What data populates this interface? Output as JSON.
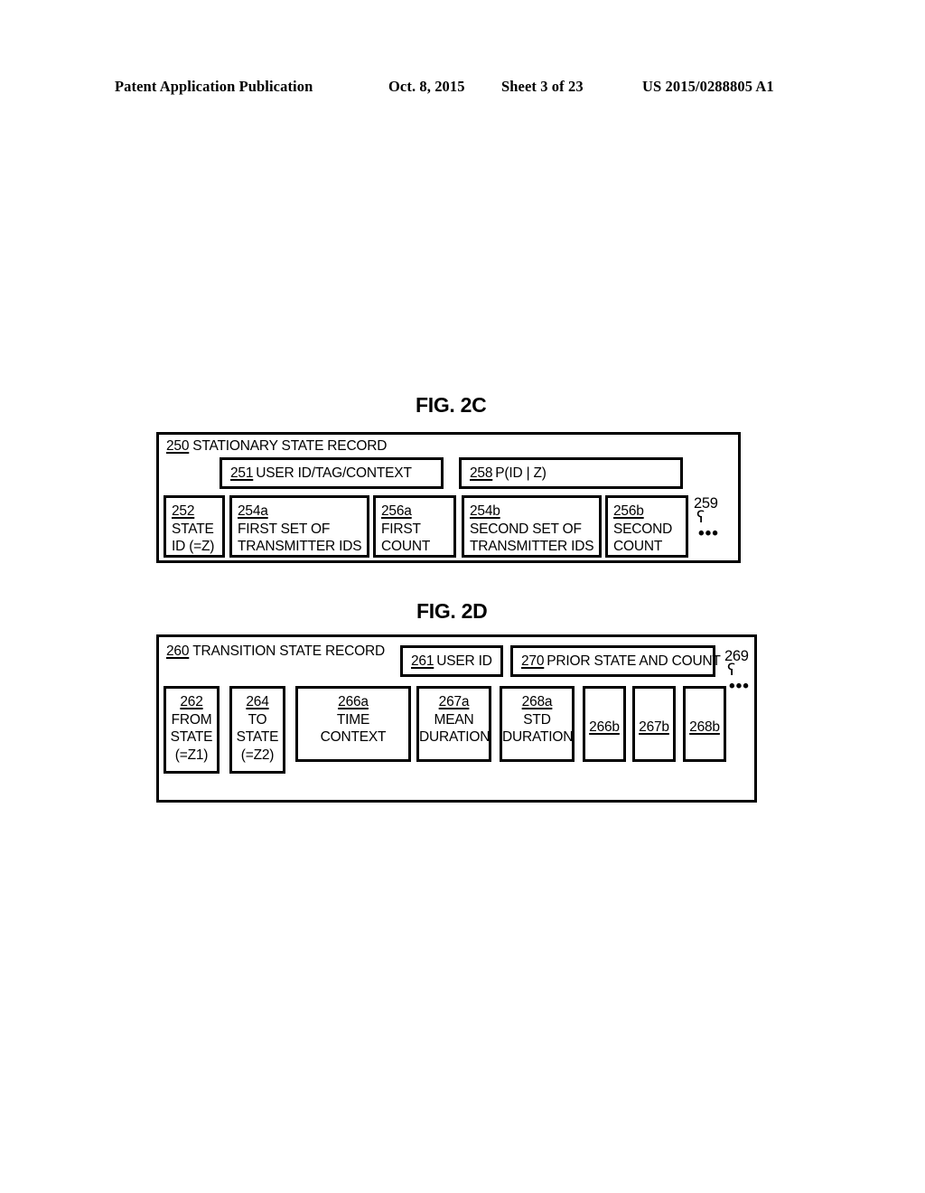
{
  "header": {
    "publication": "Patent Application Publication",
    "date": "Oct. 8, 2015",
    "sheet": "Sheet 3 of 23",
    "patent_number": "US 2015/0288805 A1"
  },
  "figures": [
    {
      "id": "fig-2c",
      "title": "FIG. 2C",
      "record": {
        "ref": "250",
        "label": "STATIONARY STATE RECORD"
      },
      "label_row": [
        {
          "ref": "251",
          "label": "USER ID/TAG/CONTEXT"
        },
        {
          "ref": "258",
          "label": "P(ID | Z)"
        }
      ],
      "field_row": [
        {
          "ref": "252",
          "lines": [
            "STATE",
            "ID (=Z)"
          ]
        },
        {
          "ref": "254a",
          "lines": [
            "FIRST SET OF",
            "TRANSMITTER IDS"
          ]
        },
        {
          "ref": "256a",
          "lines": [
            "FIRST",
            "COUNT"
          ]
        },
        {
          "ref": "254b",
          "lines": [
            "SECOND SET OF",
            "TRANSMITTER IDS"
          ]
        },
        {
          "ref": "256b",
          "lines": [
            "SECOND",
            "COUNT"
          ]
        }
      ],
      "continuation": {
        "ref": "259",
        "hook": "ʕ",
        "dots": "•••"
      }
    },
    {
      "id": "fig-2d",
      "title": "FIG. 2D",
      "record": {
        "ref": "260",
        "label": "TRANSITION STATE RECORD"
      },
      "label_row": [
        {
          "ref": "261",
          "label": "USER ID"
        },
        {
          "ref": "270",
          "label": "PRIOR STATE AND COUNT"
        }
      ],
      "field_row": [
        {
          "ref": "262",
          "lines": [
            "FROM",
            "STATE",
            "(=Z1)"
          ]
        },
        {
          "ref": "264",
          "lines": [
            "TO",
            "STATE",
            "(=Z2)"
          ]
        },
        {
          "ref": "266a",
          "lines": [
            "TIME",
            "CONTEXT"
          ]
        },
        {
          "ref": "267a",
          "lines": [
            "MEAN",
            "DURATION"
          ]
        },
        {
          "ref": "268a",
          "lines": [
            "STD",
            "DURATION"
          ]
        },
        {
          "ref": "266b",
          "lines": []
        },
        {
          "ref": "267b",
          "lines": []
        },
        {
          "ref": "268b",
          "lines": []
        }
      ],
      "continuation": {
        "ref": "269",
        "hook": "ʕ",
        "dots": "•••"
      }
    }
  ]
}
